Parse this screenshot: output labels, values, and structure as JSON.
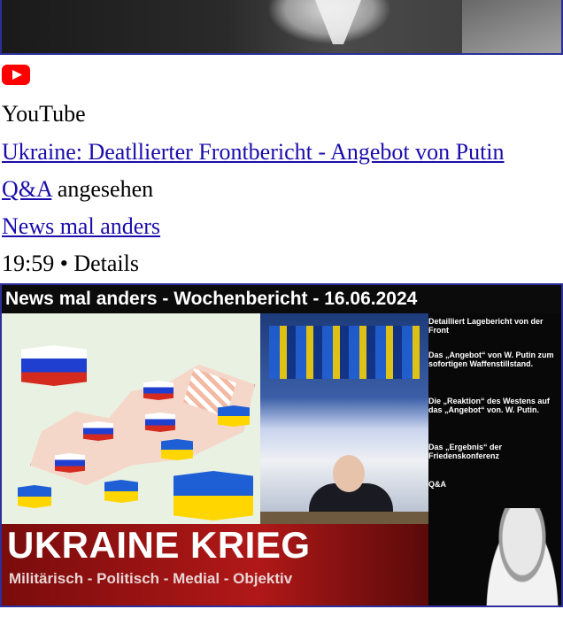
{
  "card": {
    "source": "YouTube",
    "video_title": "Ukraine: Deatllierter Frontbericht - Angebot von Putin",
    "qa_link": "Q&A",
    "qa_suffix": " angesehen",
    "channel": "News mal anders",
    "time": "19:59",
    "separator": " • ",
    "details": "Details"
  },
  "thumbnail": {
    "header": "News mal anders - Wochenbericht - 16.06.2024",
    "bullets": [
      "Detailliert Lagebericht von der Front",
      "Das „Angebot“ von W. Putin zum sofortigen Waffenstillstand.",
      "Die „Reaktion“ des Westens auf das „Angebot“ von. W. Putin.",
      "Das „Ergebnis“ der Friedenskonferenz",
      "Q&A"
    ],
    "banner_title": "UKRAINE KRIEG",
    "banner_subtitle": "Militärisch - Politisch - Medial - Objektiv"
  },
  "colors": {
    "link": "#1a0dab",
    "youtube_red": "#ff0000",
    "banner_red": "#b11818"
  },
  "icons": {
    "source_icon": "youtube-icon"
  }
}
